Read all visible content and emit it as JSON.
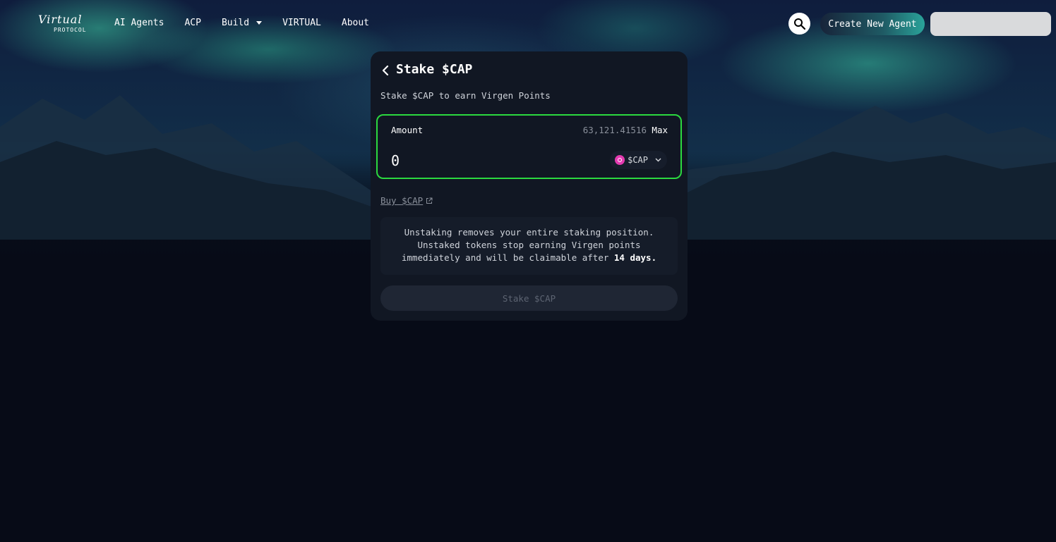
{
  "nav": {
    "logo_text": "Virtual",
    "logo_sub": "PROTOCOL",
    "links": [
      "AI Agents",
      "ACP",
      "Build",
      "VIRTUAL",
      "About"
    ],
    "create_label": "Create New Agent",
    "search_icon": "search-icon"
  },
  "stake": {
    "title": "Stake $CAP",
    "subtitle": "Stake $CAP to earn Virgen Points",
    "amount_label": "Amount",
    "balance": "63,121.41516",
    "max_label": "Max",
    "amount_value": "0",
    "token": "$CAP",
    "buy_label": "Buy $CAP",
    "notice_line1": "Unstaking removes your entire staking position.",
    "notice_line2": "Unstaked tokens stop earning Virgen points",
    "notice_line3": "immediately and will be claimable after",
    "notice_bold": "14 days.",
    "stake_button": "Stake $CAP"
  },
  "colors": {
    "accent_green": "#2bd93f",
    "card_bg": "#111723",
    "token_pink": "#e33ab0"
  }
}
